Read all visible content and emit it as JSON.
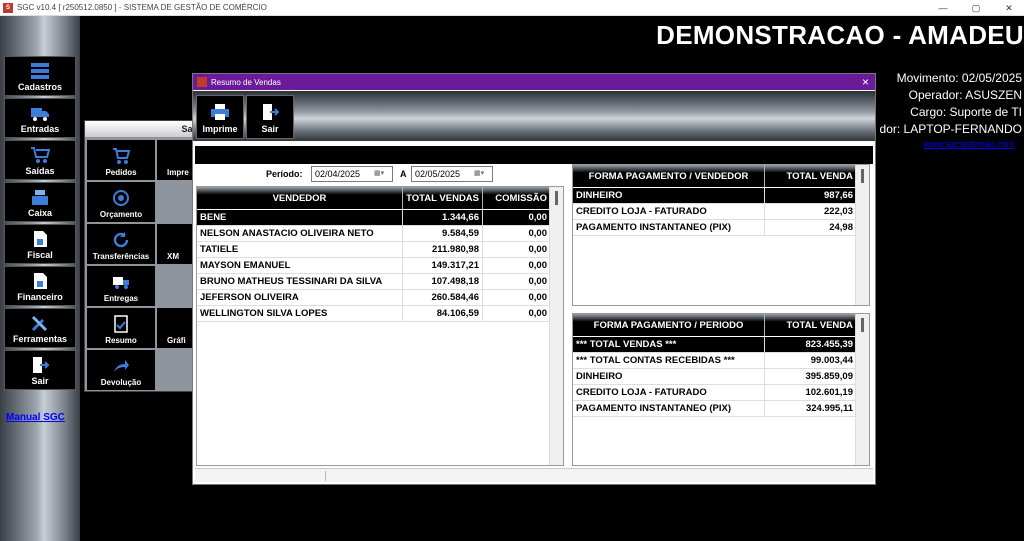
{
  "window": {
    "title": "SGC v10.4 [ r250512.0850 ] - SISTEMA DE GESTÃO DE COMÉRCIO",
    "minimize": "—",
    "maximize": "▢",
    "close": "✕"
  },
  "sidebar": {
    "items": [
      {
        "label": "Cadastros",
        "icon": "stack-icon"
      },
      {
        "label": "Entradas",
        "icon": "truck-icon"
      },
      {
        "label": "Saídas",
        "icon": "cart-icon"
      },
      {
        "label": "Caixa",
        "icon": "register-icon"
      },
      {
        "label": "Fiscal",
        "icon": "document-icon"
      },
      {
        "label": "Financeiro",
        "icon": "document-icon"
      },
      {
        "label": "Ferramentas",
        "icon": "tools-icon"
      },
      {
        "label": "Sair",
        "icon": "exit-icon"
      }
    ],
    "manual_link": "Manual SGC"
  },
  "header": {
    "title": "DEMONSTRACAO - AMADEU",
    "movimento": "Movimento: 02/05/2025",
    "operador": "Operador: ASUSZEN",
    "cargo": "Cargo: Suporte de TI",
    "computador": "dor: LAPTOP-FERNANDO",
    "site": "www.sgcsistemas.com"
  },
  "submenu": {
    "title": "Saí",
    "items": [
      {
        "label": "Pedidos",
        "icon": "cart-icon"
      },
      {
        "label": "Orçamento",
        "icon": "target-icon"
      },
      {
        "label": "Transferências",
        "icon": "refresh-icon"
      },
      {
        "label": "Entregas",
        "icon": "delivery-icon"
      },
      {
        "label": "Resumo",
        "icon": "report-icon"
      },
      {
        "label": "Devolução",
        "icon": "return-arrow-icon"
      }
    ],
    "right_items": [
      "Impre",
      "",
      "XM",
      "",
      "Gráfi"
    ]
  },
  "dialog": {
    "title": "Resumo de Vendas",
    "close": "×",
    "toolbar": {
      "print_label": "Imprime",
      "exit_label": "Sair"
    },
    "period": {
      "label": "Período:",
      "from": "02/04/2025",
      "to_label": "A",
      "to": "02/05/2025"
    },
    "vendors": {
      "columns": [
        "VENDEDOR",
        "TOTAL VENDAS",
        "COMISSÃO"
      ],
      "rows": [
        {
          "name": "BENE",
          "total": "1.344,66",
          "commission": "0,00"
        },
        {
          "name": "NELSON ANASTACIO OLIVEIRA NETO",
          "total": "9.584,59",
          "commission": "0,00"
        },
        {
          "name": "TATIELE",
          "total": "211.980,98",
          "commission": "0,00"
        },
        {
          "name": "MAYSON EMANUEL",
          "total": "149.317,21",
          "commission": "0,00"
        },
        {
          "name": "BRUNO MATHEUS TESSINARI DA SILVA",
          "total": "107.498,18",
          "commission": "0,00"
        },
        {
          "name": "JEFERSON OLIVEIRA",
          "total": "260.584,46",
          "commission": "0,00"
        },
        {
          "name": "WELLINGTON SILVA LOPES",
          "total": "84.106,59",
          "commission": "0,00"
        }
      ]
    },
    "payment_by_vendor": {
      "columns": [
        "FORMA PAGAMENTO / VENDEDOR",
        "TOTAL VENDA"
      ],
      "rows": [
        {
          "label": "DINHEIRO",
          "value": "987,66"
        },
        {
          "label": "CREDITO LOJA - FATURADO",
          "value": "222,03"
        },
        {
          "label": "PAGAMENTO INSTANTANEO (PIX)",
          "value": "24,98"
        }
      ]
    },
    "payment_by_period": {
      "columns": [
        "FORMA PAGAMENTO / PERIODO",
        "TOTAL VENDA"
      ],
      "rows": [
        {
          "label": "*** TOTAL VENDAS ***",
          "value": "823.455,39"
        },
        {
          "label": "*** TOTAL CONTAS RECEBIDAS ***",
          "value": "99.003,44"
        },
        {
          "label": "DINHEIRO",
          "value": "395.859,09"
        },
        {
          "label": "CREDITO LOJA - FATURADO",
          "value": "102.601,19"
        },
        {
          "label": "PAGAMENTO INSTANTANEO (PIX)",
          "value": "324.995,11"
        }
      ]
    }
  }
}
